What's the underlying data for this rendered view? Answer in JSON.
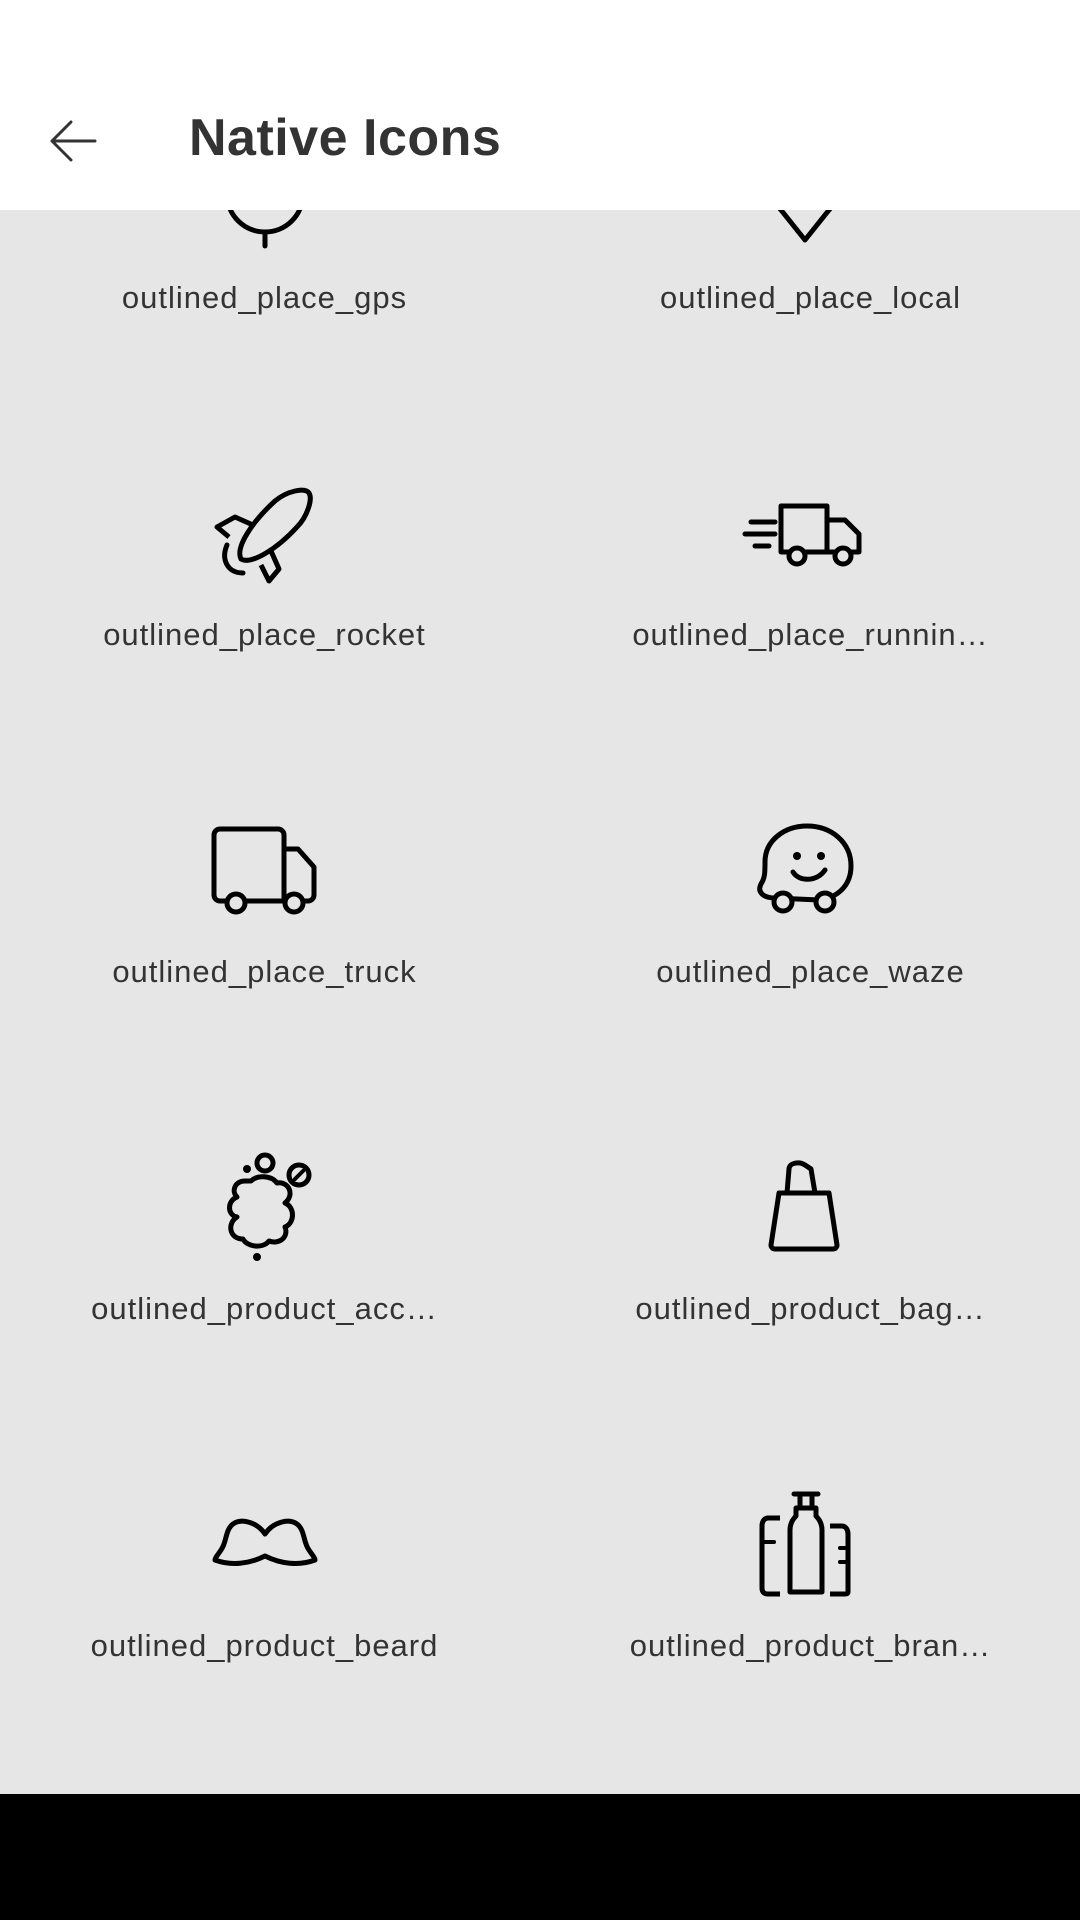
{
  "header": {
    "title": "Native Icons",
    "back_icon": "arrow-left-icon"
  },
  "icons": [
    {
      "label": "outlined_place_gps",
      "icon": "gps-icon"
    },
    {
      "label": "outlined_place_local",
      "icon": "location-pin-icon"
    },
    {
      "label": "outlined_place_rocket",
      "icon": "rocket-icon"
    },
    {
      "label": "outlined_place_runnin…",
      "icon": "fast-delivery-truck-icon"
    },
    {
      "label": "outlined_place_truck",
      "icon": "truck-icon"
    },
    {
      "label": "outlined_place_waze",
      "icon": "waze-icon"
    },
    {
      "label": "outlined_product_acc…",
      "icon": "accessories-icon"
    },
    {
      "label": "outlined_product_bag…",
      "icon": "bag-icon"
    },
    {
      "label": "outlined_product_beard",
      "icon": "beard-icon"
    },
    {
      "label": "outlined_product_bran…",
      "icon": "bottles-icon"
    }
  ]
}
